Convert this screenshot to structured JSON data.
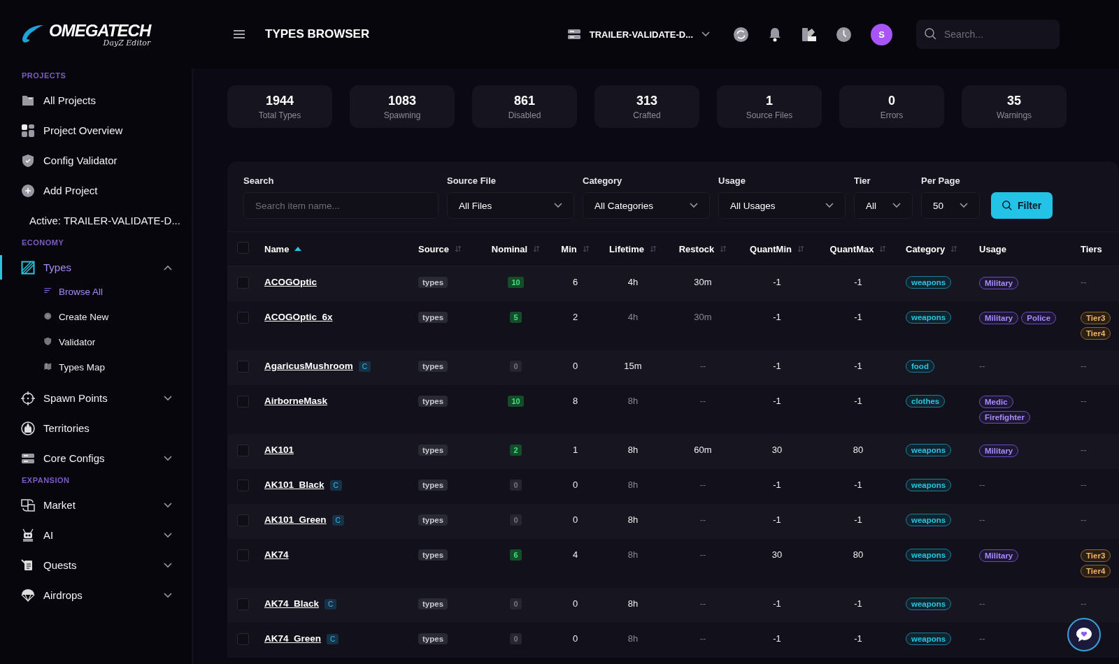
{
  "logo": {
    "brand": "OMEGATECH",
    "tagline": "DayZ Editor"
  },
  "sidebar": {
    "sections": [
      {
        "title": "PROJECTS",
        "items": [
          {
            "label": "All Projects",
            "selected": false
          },
          {
            "label": "Project Overview",
            "selected": false
          },
          {
            "label": "Config Validator",
            "selected": false
          },
          {
            "label": "Add Project",
            "selected": false
          },
          {
            "label": "Active: TRAILER-VALIDATE-D...",
            "selected": false
          }
        ]
      },
      {
        "title": "ECONOMY",
        "items": [
          {
            "label": "Types",
            "selected": true,
            "expanded": true,
            "children": [
              {
                "label": "Browse All",
                "selected": true
              },
              {
                "label": "Create New",
                "selected": false
              },
              {
                "label": "Validator",
                "selected": false
              },
              {
                "label": "Types Map",
                "selected": false
              }
            ]
          },
          {
            "label": "Spawn Points",
            "selected": false,
            "expanded": false
          },
          {
            "label": "Territories",
            "selected": false
          },
          {
            "label": "Core Configs",
            "selected": false,
            "expanded": false
          }
        ]
      },
      {
        "title": "EXPANSION",
        "items": [
          {
            "label": "Market",
            "selected": false,
            "expanded": false
          },
          {
            "label": "AI",
            "selected": false,
            "expanded": false
          },
          {
            "label": "Quests",
            "selected": false,
            "expanded": false
          },
          {
            "label": "Airdrops",
            "selected": false,
            "expanded": false
          }
        ]
      }
    ]
  },
  "header": {
    "title": "TYPES BROWSER",
    "project": "TRAILER-VALIDATE-D...",
    "avatar": "S",
    "search": {
      "placeholder": "Search..."
    }
  },
  "stats": [
    {
      "value": "1944",
      "label": "Total Types"
    },
    {
      "value": "1083",
      "label": "Spawning"
    },
    {
      "value": "861",
      "label": "Disabled"
    },
    {
      "value": "313",
      "label": "Crafted"
    },
    {
      "value": "1",
      "label": "Source Files"
    },
    {
      "value": "0",
      "label": "Errors"
    },
    {
      "value": "35",
      "label": "Warnings"
    }
  ],
  "filters": [
    {
      "kind": "text",
      "label": "Search",
      "placeholder": "Search item name..."
    },
    {
      "kind": "select",
      "label": "Source File",
      "value": "All Files"
    },
    {
      "kind": "select",
      "label": "Category",
      "value": "All Categories"
    },
    {
      "kind": "select",
      "label": "Usage",
      "value": "All Usages"
    },
    {
      "kind": "select",
      "label": "Tier",
      "value": "All"
    },
    {
      "kind": "select",
      "label": "Per Page",
      "value": "50"
    }
  ],
  "filter_button": "Filter",
  "table": {
    "all_checked": false,
    "columns": [
      {
        "label": "Name",
        "sortable": true,
        "sorted": true
      },
      {
        "label": "Source",
        "sortable": true,
        "sorted": false
      },
      {
        "label": "Nominal",
        "sortable": true,
        "sorted": false
      },
      {
        "label": "Min",
        "sortable": true,
        "sorted": false
      },
      {
        "label": "Lifetime",
        "sortable": true,
        "sorted": false
      },
      {
        "label": "Restock",
        "sortable": true,
        "sorted": false
      },
      {
        "label": "QuantMin",
        "sortable": true,
        "sorted": false
      },
      {
        "label": "QuantMax",
        "sortable": true,
        "sorted": false
      },
      {
        "label": "Category",
        "sortable": true,
        "sorted": false
      },
      {
        "label": "Usage",
        "sortable": false
      },
      {
        "label": "Tiers",
        "sortable": false
      }
    ],
    "rows": [
      {
        "checked": false,
        "name": "ACOGOptic",
        "source": "types",
        "nominal": "10",
        "nominal_active": true,
        "min": "6",
        "lifetime": "4h",
        "restock": "30m",
        "quantmin": "-1",
        "quantmax": "-1",
        "category": "weapons",
        "usage": [
          "Military"
        ],
        "tiers": []
      },
      {
        "checked": false,
        "name": "ACOGOptic_6x",
        "source": "types",
        "nominal": "5",
        "nominal_active": true,
        "min": "2",
        "lifetime": "4h",
        "restock": "30m",
        "quantmin": "-1",
        "quantmax": "-1",
        "category": "weapons",
        "usage": [
          "Military",
          "Police"
        ],
        "tiers": [
          "Tier3",
          "Tier4"
        ]
      },
      {
        "checked": false,
        "name": "AgaricusMushroom",
        "crafted_tag": "C",
        "source": "types",
        "nominal": "0",
        "nominal_active": false,
        "min": "0",
        "lifetime": "15m",
        "restock": "--",
        "quantmin": "-1",
        "quantmax": "-1",
        "category": "food",
        "usage": [],
        "tiers": []
      },
      {
        "checked": false,
        "name": "AirborneMask",
        "source": "types",
        "nominal": "10",
        "nominal_active": true,
        "min": "8",
        "lifetime": "8h",
        "restock": "--",
        "quantmin": "-1",
        "quantmax": "-1",
        "category": "clothes",
        "usage": [
          "Medic",
          "Firefighter"
        ],
        "tiers": []
      },
      {
        "checked": false,
        "name": "AK101",
        "source": "types",
        "nominal": "2",
        "nominal_active": true,
        "min": "1",
        "lifetime": "8h",
        "restock": "60m",
        "quantmin": "30",
        "quantmax": "80",
        "category": "weapons",
        "usage": [
          "Military"
        ],
        "tiers": []
      },
      {
        "checked": false,
        "name": "AK101_Black",
        "crafted_tag": "C",
        "source": "types",
        "nominal": "0",
        "nominal_active": false,
        "min": "0",
        "lifetime": "8h",
        "restock": "--",
        "quantmin": "-1",
        "quantmax": "-1",
        "category": "weapons",
        "usage": [],
        "tiers": []
      },
      {
        "checked": false,
        "name": "AK101_Green",
        "crafted_tag": "C",
        "source": "types",
        "nominal": "0",
        "nominal_active": false,
        "min": "0",
        "lifetime": "8h",
        "restock": "--",
        "quantmin": "-1",
        "quantmax": "-1",
        "category": "weapons",
        "usage": [],
        "tiers": []
      },
      {
        "checked": false,
        "name": "AK74",
        "source": "types",
        "nominal": "6",
        "nominal_active": true,
        "min": "4",
        "lifetime": "8h",
        "restock": "--",
        "quantmin": "30",
        "quantmax": "80",
        "category": "weapons",
        "usage": [
          "Military"
        ],
        "tiers": [
          "Tier3",
          "Tier4"
        ]
      },
      {
        "checked": false,
        "name": "AK74_Black",
        "crafted_tag": "C",
        "source": "types",
        "nominal": "0",
        "nominal_active": false,
        "min": "0",
        "lifetime": "8h",
        "restock": "--",
        "quantmin": "-1",
        "quantmax": "-1",
        "category": "weapons",
        "usage": [],
        "tiers": []
      },
      {
        "checked": false,
        "name": "AK74_Green",
        "crafted_tag": "C",
        "source": "types",
        "nominal": "0",
        "nominal_active": false,
        "min": "0",
        "lifetime": "8h",
        "restock": "--",
        "quantmin": "-1",
        "quantmax": "-1",
        "category": "weapons",
        "usage": [],
        "tiers": []
      }
    ],
    "empty_mark": "--"
  }
}
